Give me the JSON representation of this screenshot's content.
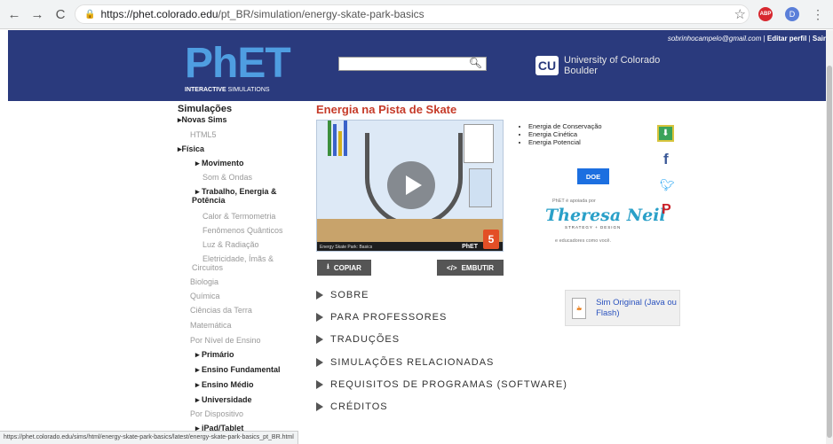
{
  "browser": {
    "url_host": "https://phet.colorado.edu",
    "url_path": "/pt_BR/simulation/energy-skate-park-basics",
    "back": "←",
    "forward": "→",
    "reload": "C",
    "star": "☆",
    "adblock": "ABP",
    "profile": "D",
    "menu": "⋮",
    "status_url": "https://phet.colorado.edu/sims/html/energy-skate-park-basics/latest/energy-skate-park-basics_pt_BR.html"
  },
  "header": {
    "logo": "PhET",
    "logo_sub_bold": "INTERACTIVE",
    "logo_sub": " SIMULATIONS",
    "search_icon": "magnifier",
    "cu_line1": "University of Colorado",
    "cu_line2": "Boulder",
    "email": "sobrinhocampelo@gmail.com",
    "sep": " | ",
    "edit_profile": "Editar perfil",
    "logout": "Sair",
    "colors": {
      "bg": "#2a3a7d",
      "logo": "#4f9ee1"
    }
  },
  "sidebar": {
    "title": "Simulações",
    "items": [
      {
        "label": "Novas Sims",
        "style": "bold",
        "arrow": true
      },
      {
        "label": "HTML5",
        "style": "gray"
      },
      {
        "label": "Física",
        "style": "bold",
        "arrow": true
      },
      {
        "label": "Movimento",
        "style": "bold",
        "arrow": true
      },
      {
        "label": "Som & Ondas",
        "style": "gray"
      },
      {
        "label": "Trabalho, Energia &",
        "style": "bold",
        "arrow": true
      },
      {
        "label": "Potência",
        "style": "bold"
      },
      {
        "label": "Calor & Termometria",
        "style": "gray"
      },
      {
        "label": "Fenômenos Quânticos",
        "style": "gray"
      },
      {
        "label": "Luz & Radiação",
        "style": "gray"
      },
      {
        "label": "Eletricidade, Ímãs &",
        "style": "gray"
      },
      {
        "label": "Circuitos",
        "style": "gray"
      },
      {
        "label": "Biologia",
        "style": "gray"
      },
      {
        "label": "Química",
        "style": "gray"
      },
      {
        "label": "Ciências da Terra",
        "style": "gray"
      },
      {
        "label": "Matemática",
        "style": "gray"
      },
      {
        "label": "Por Nível de Ensino",
        "style": "gray"
      },
      {
        "label": "Primário",
        "style": "bold",
        "arrow": true
      },
      {
        "label": "Ensino Fundamental",
        "style": "bold",
        "arrow": true
      },
      {
        "label": "Ensino Médio",
        "style": "bold",
        "arrow": true
      },
      {
        "label": "Universidade",
        "style": "bold",
        "arrow": true
      },
      {
        "label": "Por Dispositivo",
        "style": "gray"
      },
      {
        "label": "iPad/Tablet",
        "style": "bold",
        "arrow": true
      }
    ]
  },
  "main": {
    "title": "Energia na Pista de Skate",
    "sim_label": "Energy Skate Park: Basics",
    "sim_brand": "PhET",
    "html5_badge": "5",
    "copy_button": "COPIAR",
    "embed_button": "EMBUTIR",
    "topics": [
      "Energia de Conservação",
      "Energia Cinética",
      "Energia Potencial"
    ],
    "donate": "DOE",
    "supported_by": "PhET é apoiada por",
    "sponsor": "Theresa Neil",
    "sponsor_sub": "STRATEGY + DESIGN",
    "and_educators": "e educadores como você.",
    "share": {
      "facebook": "f",
      "pinterest": "P"
    },
    "accordion": [
      "SOBRE",
      "PARA PROFESSORES",
      "TRADUÇÕES",
      "SIMULAÇÕES RELACIONADAS",
      "REQUISITOS DE PROGRAMAS (SOFTWARE)",
      "CRÉDITOS"
    ],
    "original_sim": "Sim Original (Java ou Flash)"
  }
}
